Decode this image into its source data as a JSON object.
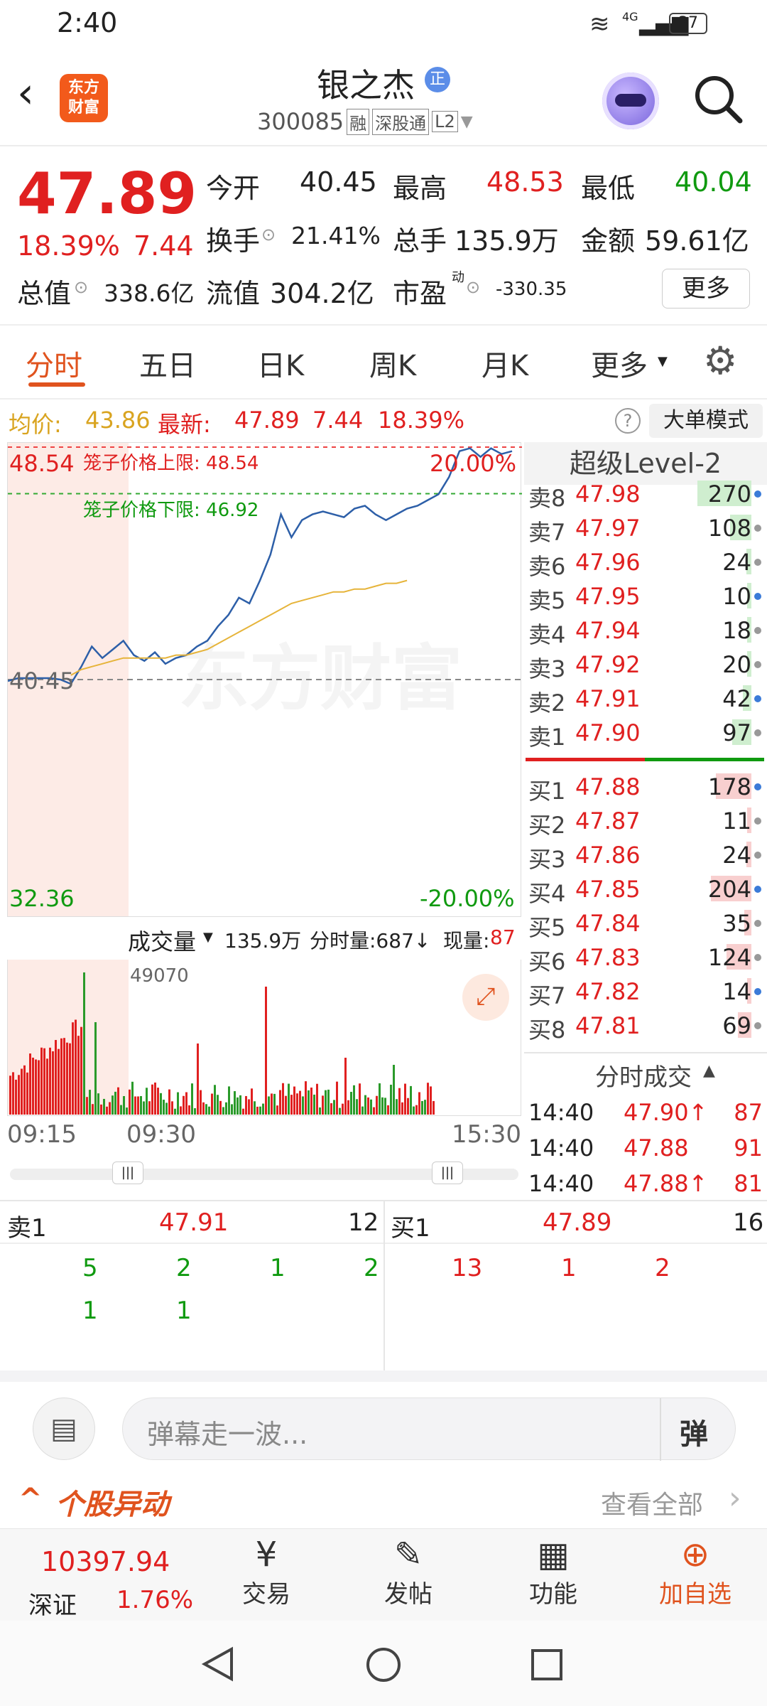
{
  "status_bar": {
    "time": "2:40",
    "battery": "37",
    "network": "4G"
  },
  "header": {
    "logo": "东方\n财富",
    "name": "银之杰",
    "badge": "正",
    "code": "300085",
    "tags": [
      "融",
      "深股通",
      "L2"
    ]
  },
  "quote": {
    "price": "47.89",
    "pct": "18.39%",
    "change": "7.44",
    "open_label": "今开",
    "open": "40.45",
    "high_label": "最高",
    "high": "48.53",
    "low_label": "最低",
    "low": "40.04",
    "turnover_label": "换手",
    "turnover": "21.41%",
    "vol_label": "总手",
    "vol": "135.9万",
    "amount_label": "金额",
    "amount": "59.61亿",
    "mcap_label": "总值",
    "mcap": "338.6亿",
    "float_label": "流值",
    "float": "304.2亿",
    "pe_label": "市盈",
    "pe_sup": "动",
    "pe": "-330.35",
    "more": "更多"
  },
  "tabs": [
    "分时",
    "五日",
    "日K",
    "周K",
    "月K",
    "更多"
  ],
  "avgbar": {
    "avg_label": "均价:",
    "avg": "43.86",
    "latest_label": "最新:",
    "latest": "47.89",
    "chg": "7.44",
    "pct": "18.39%",
    "bigmode": "大单模式"
  },
  "chart": {
    "top_price": "48.54",
    "bottom_price": "32.36",
    "top_pct": "20.00%",
    "bottom_pct": "-20.00%",
    "base": "40.45",
    "upper_limit": "笼子价格上限:  48.54",
    "lower_limit": "笼子价格下限:  46.92",
    "watermark": "东方财富"
  },
  "chart_data": {
    "type": "line",
    "ylim": [
      32.36,
      48.54
    ],
    "base": 40.45,
    "price": [
      40.4,
      40.5,
      40.5,
      40.5,
      40.5,
      40.45,
      40.3,
      40.9,
      41.6,
      41.2,
      41.5,
      41.8,
      41.3,
      41.1,
      41.4,
      41.0,
      41.2,
      41.3,
      41.6,
      41.8,
      42.3,
      42.7,
      43.3,
      43.1,
      43.9,
      44.8,
      46.2,
      45.4,
      46.0,
      46.2,
      46.3,
      46.2,
      46.1,
      46.4,
      46.5,
      46.2,
      46.0,
      46.2,
      46.4,
      46.5,
      46.7,
      46.9,
      47.5,
      48.4,
      48.5,
      48.2,
      48.5,
      48.3,
      48.4
    ],
    "avg": [
      null,
      null,
      null,
      null,
      null,
      null,
      40.6,
      40.8,
      40.9,
      41.0,
      41.1,
      41.2,
      41.2,
      41.2,
      41.2,
      41.2,
      41.3,
      41.3,
      41.4,
      41.5,
      41.7,
      41.9,
      42.1,
      42.3,
      42.5,
      42.7,
      42.9,
      43.1,
      43.2,
      43.3,
      43.4,
      43.5,
      43.5,
      43.6,
      43.6,
      43.7,
      43.8,
      43.8,
      43.9
    ]
  },
  "volume": {
    "label": "成交量",
    "total": "135.9万",
    "minute_label": "分时量:687↓",
    "now_label": "现量:",
    "now": "87",
    "max": "49070",
    "t1": "09:15",
    "t2": "09:30",
    "t3": "15:30"
  },
  "level2": {
    "title": "超级Level-2",
    "asks": [
      [
        "卖8",
        "47.98",
        "270"
      ],
      [
        "卖7",
        "47.97",
        "108"
      ],
      [
        "卖6",
        "47.96",
        "24"
      ],
      [
        "卖5",
        "47.95",
        "10"
      ],
      [
        "卖4",
        "47.94",
        "18"
      ],
      [
        "卖3",
        "47.92",
        "20"
      ],
      [
        "卖2",
        "47.91",
        "42"
      ],
      [
        "卖1",
        "47.90",
        "97"
      ]
    ],
    "bids": [
      [
        "买1",
        "47.88",
        "178"
      ],
      [
        "买2",
        "47.87",
        "11"
      ],
      [
        "买3",
        "47.86",
        "24"
      ],
      [
        "买4",
        "47.85",
        "204"
      ],
      [
        "买5",
        "47.84",
        "35"
      ],
      [
        "买6",
        "47.83",
        "124"
      ],
      [
        "买7",
        "47.82",
        "14"
      ],
      [
        "买8",
        "47.81",
        "69"
      ]
    ],
    "trades_title": "分时成交",
    "trades": [
      [
        "14:40",
        "47.90↑",
        "87"
      ],
      [
        "14:40",
        "47.88",
        "91"
      ],
      [
        "14:40",
        "47.88↑",
        "81"
      ]
    ]
  },
  "queue": {
    "sell_label": "卖1",
    "sell_price": "47.91",
    "sell_qty": "12",
    "buy_label": "买1",
    "buy_price": "47.89",
    "buy_qty": "16",
    "sell_items": [
      "5",
      "2",
      "1",
      "2",
      "1",
      "1"
    ],
    "buy_items": [
      "13",
      "1",
      "2"
    ]
  },
  "comment": {
    "placeholder": "弹幕走一波...",
    "btn": "弹",
    "section": "个股异动",
    "viewall": "查看全部"
  },
  "nav": {
    "index": "10397.94",
    "index_name": "深证",
    "index_pct": "1.76%",
    "items": [
      "交易",
      "发帖",
      "功能",
      "加自选"
    ]
  }
}
